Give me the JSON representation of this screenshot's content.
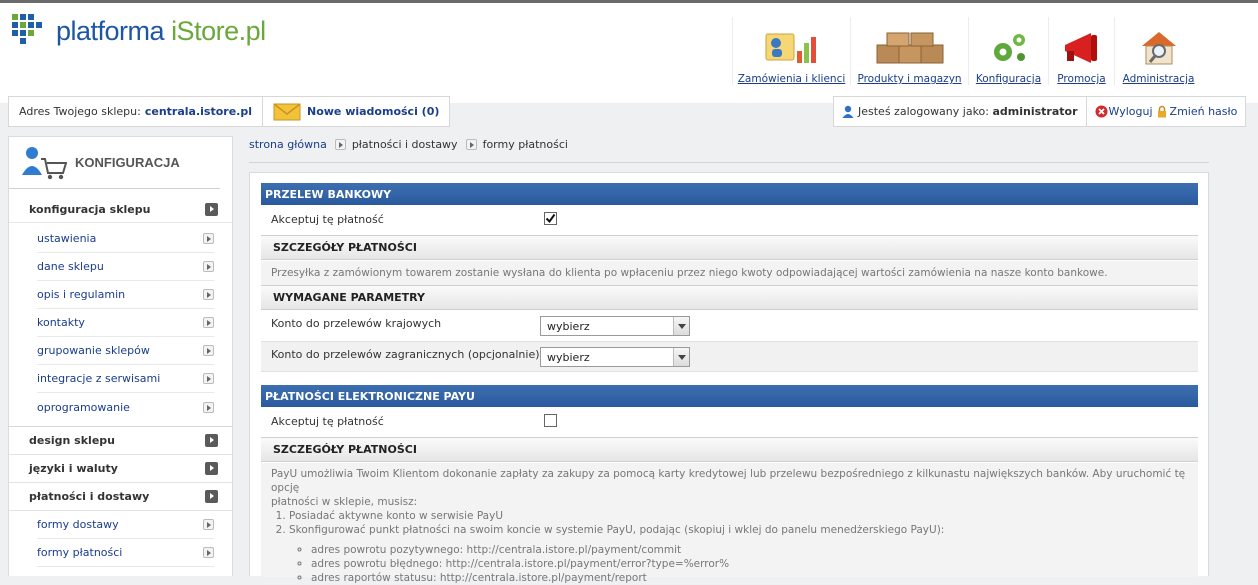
{
  "brand": {
    "name_part1": "platforma ",
    "name_part2": "iStore.pl"
  },
  "topnav": [
    {
      "label": "Zamówienia i klienci",
      "icon": "orders-chart-icon"
    },
    {
      "label": "Produkty i magazyn",
      "icon": "boxes-icon"
    },
    {
      "label": "Konfiguracja",
      "icon": "gears-icon"
    },
    {
      "label": "Promocja",
      "icon": "megaphone-icon"
    },
    {
      "label": "Administracja",
      "icon": "house-magnifier-icon"
    }
  ],
  "infobar": {
    "address_label": "Adres Twojego sklepu:",
    "address_link": "centrala.istore.pl",
    "messages_link": "Nowe wiadomości (0)",
    "logged_label": "Jesteś zalogowany jako:",
    "logged_user": "administrator",
    "logout": "Wyloguj",
    "change_password": "Zmień hasło"
  },
  "sidebar": {
    "title": "KONFIGURACJA",
    "sections": [
      {
        "label": "konfiguracja sklepu",
        "items": [
          "ustawienia",
          "dane sklepu",
          "opis i regulamin",
          "kontakty",
          "grupowanie sklepów",
          "integracje z serwisami",
          "oprogramowanie"
        ]
      },
      {
        "label": "design sklepu",
        "items": []
      },
      {
        "label": "języki i waluty",
        "items": []
      },
      {
        "label": "płatności i dostawy",
        "items": [
          "formy dostawy",
          "formy płatności"
        ]
      }
    ]
  },
  "breadcrumb": {
    "home": "strona główna",
    "level1": "płatności i dostawy",
    "level2": "formy płatności"
  },
  "bank_transfer": {
    "title": "PRZELEW BANKOWY",
    "accept_label": "Akceptuj tę płatność",
    "accepted": true,
    "details_title": "SZCZEGÓŁY PŁATNOŚCI",
    "details_text": "Przesyłka z zamówionym towarem zostanie wysłana do klienta po wpłaceniu przez niego kwoty odpowiadającej wartości zamówienia na nasze konto bankowe.",
    "params_title": "WYMAGANE PARAMETRY",
    "domestic_label": "Konto do przelewów krajowych",
    "domestic_value": "wybierz",
    "foreign_label": "Konto do przelewów zagranicznych (opcjonalnie)",
    "foreign_value": "wybierz"
  },
  "payu": {
    "title": "PŁATNOŚCI ELEKTRONICZNE PAYU",
    "accept_label": "Akceptuj tę płatność",
    "accepted": false,
    "details_title": "SZCZEGÓŁY PŁATNOŚCI",
    "intro_line1": "PayU umożliwia Twoim Klientom dokonanie zapłaty za zakupy za pomocą karty kredytowej lub przelewu bezpośredniego z kilkunastu największych banków. Aby uruchomić tę opcję",
    "intro_line2": "płatności w sklepie, musisz:",
    "step1": "Posiadać aktywne konto w serwisie PayU",
    "step2": "Skonfigurować punkt płatności na swoim koncie w systemie PayU, podając (skopiuj i wklej do panelu menedżerskiego PayU):",
    "url_ok": "adres powrotu pozytywnego: http://centrala.istore.pl/payment/commit",
    "url_err": "adres powrotu błędnego: http://centrala.istore.pl/payment/error?type=%error%",
    "url_report": "adres raportów statusu: http://centrala.istore.pl/payment/report"
  },
  "colors": {
    "accent_blue": "#2a5a9e",
    "brand_green": "#6aa83b",
    "link": "#1a3d8c"
  }
}
